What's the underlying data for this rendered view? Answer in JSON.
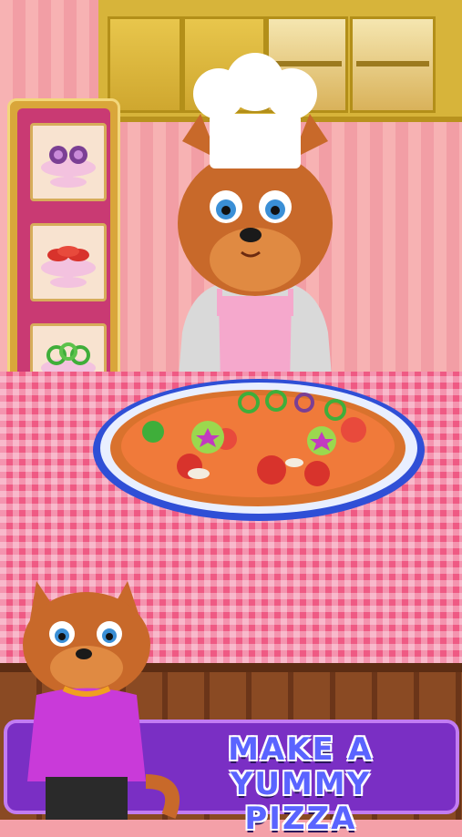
{
  "banner": {
    "line1": "MAKE A YUMMY",
    "line2": "PIZZA"
  },
  "ingredient_slots": [
    {
      "name": "onion-rings"
    },
    {
      "name": "tomato-slices"
    },
    {
      "name": "green-pepper-rings"
    }
  ],
  "colors": {
    "banner_bg": "#7a2fc4",
    "table": "#ef5a84",
    "panel": "#c93a73",
    "cabinet": "#d7b43a"
  }
}
